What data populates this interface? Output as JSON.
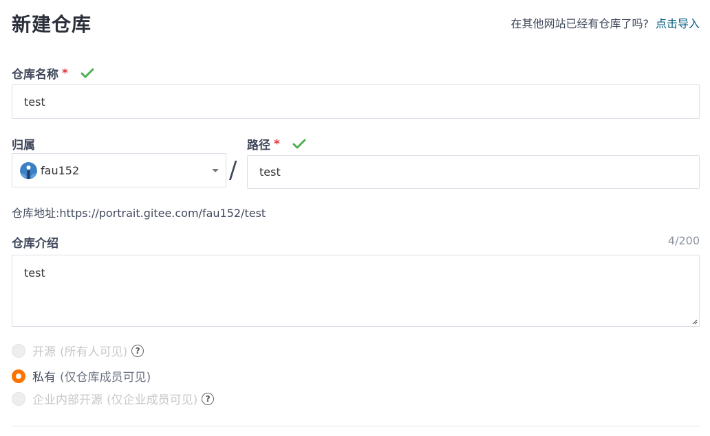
{
  "header": {
    "title": "新建仓库",
    "import_prompt": "在其他网站已经有仓库了吗?",
    "import_link": "点击导入"
  },
  "repo_name": {
    "label": "仓库名称",
    "required_mark": "*",
    "value": "test"
  },
  "owner": {
    "label": "归属",
    "selected": "fau152"
  },
  "separator": "/",
  "path": {
    "label": "路径",
    "required_mark": "*",
    "value": "test"
  },
  "address": {
    "text": "仓库地址:https://portrait.gitee.com/fau152/test"
  },
  "description": {
    "label": "仓库介绍",
    "counter": "4/200",
    "value": "test"
  },
  "visibility": {
    "options": [
      {
        "label": "开源",
        "hint": "(所有人可见)",
        "state": "disabled",
        "help": "?"
      },
      {
        "label": "私有",
        "hint": "(仅仓库成员可见)",
        "state": "checked"
      },
      {
        "label": "企业内部开源",
        "hint": "(仅企业成员可见)",
        "state": "disabled",
        "help": "?"
      }
    ]
  },
  "colors": {
    "accent": "#fe7300",
    "valid": "#4caf50",
    "link": "#005980",
    "required": "#e5323e"
  },
  "icons": {
    "check": "checkmark-icon",
    "caret": "chevron-down-icon",
    "help": "question-circle-icon"
  }
}
